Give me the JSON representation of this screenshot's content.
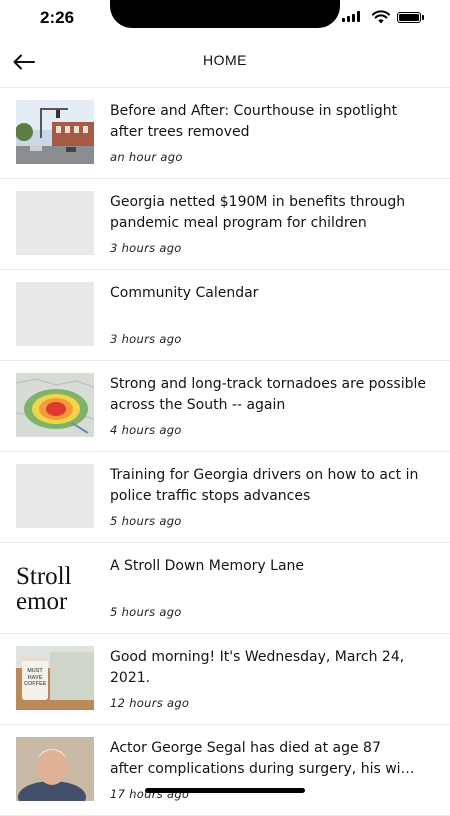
{
  "status_bar": {
    "time": "2:26"
  },
  "nav": {
    "title": "HOME"
  },
  "articles": [
    {
      "headline": "Before and After: Courthouse in spotlight after trees removed",
      "time": "an hour ago",
      "thumb": "courthouse-photo"
    },
    {
      "headline": "Georgia netted $190M in benefits through pandemic meal program for children",
      "time": "3 hours ago",
      "thumb": "placeholder"
    },
    {
      "headline": "Community Calendar",
      "time": "3 hours ago",
      "thumb": "placeholder"
    },
    {
      "headline": "Strong and long-track tornadoes are possible across the South -- again",
      "time": "4 hours ago",
      "thumb": "weather-map"
    },
    {
      "headline": "Training for Georgia drivers on how to act in police traffic stops advances",
      "time": "5 hours ago",
      "thumb": "placeholder"
    },
    {
      "headline": "A Stroll Down Memory Lane",
      "time": "5 hours ago",
      "thumb": "stroll-text"
    },
    {
      "headline": "Good morning! It's Wednesday, March 24, 2021.",
      "time": "12 hours ago",
      "thumb": "coffee-cup"
    },
    {
      "headline_line1": "Actor George Segal has died at age 87",
      "headline_line2": "after complications during surgery, his wi…",
      "time": "17 hours ago",
      "thumb": "portrait"
    }
  ],
  "thumb_text": {
    "stroll_line1": "Stroll",
    "stroll_line2": "emor",
    "coffee_label": "MUST HAVE COFFEE"
  }
}
